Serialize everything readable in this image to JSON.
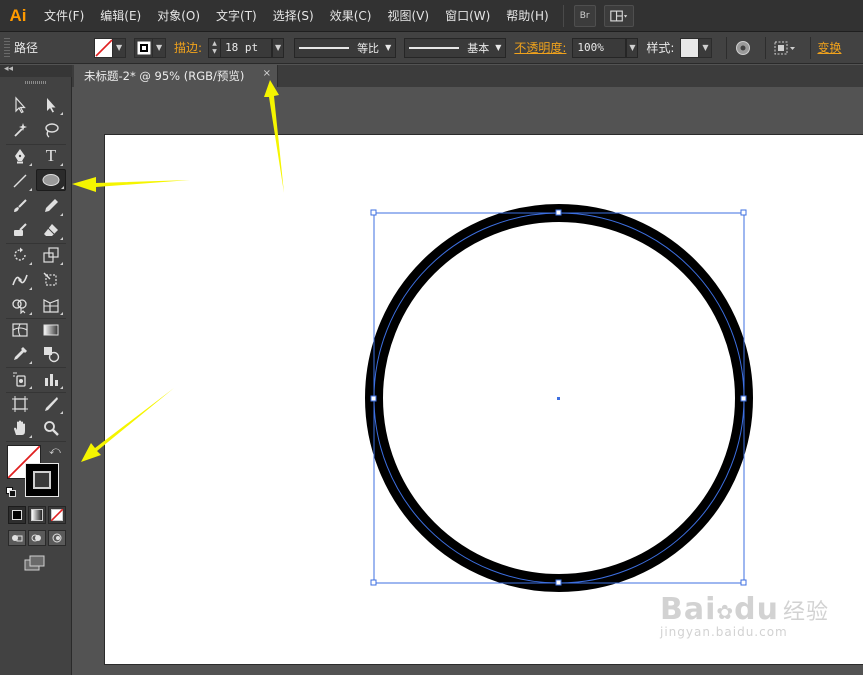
{
  "app": {
    "logo": "Ai"
  },
  "menu": [
    "文件(F)",
    "编辑(E)",
    "对象(O)",
    "文字(T)",
    "选择(S)",
    "效果(C)",
    "视图(V)",
    "窗口(W)",
    "帮助(H)"
  ],
  "menubar_buttons": {
    "bridge": "Br"
  },
  "controlbar": {
    "selection_type": "路径",
    "stroke_label": "描边:",
    "stroke_weight": "18 pt",
    "profile_label": "等比",
    "brush_label": "基本",
    "opacity_label": "不透明度:",
    "opacity_value": "100%",
    "style_label": "样式:",
    "transform_label": "变换"
  },
  "document": {
    "tab_title": "未标题-2* @ 95% (RGB/预览)",
    "tab_close": "×"
  },
  "tools": {
    "active": "ellipse-tool",
    "type_tool_glyph": "T"
  },
  "watermark": {
    "brand_latin": "Bai",
    "brand_du": "du",
    "brand_cn": "经验",
    "url": "jingyan.baidu.com"
  },
  "colors": {
    "accent_orange": "#f0a21c",
    "arrow_yellow": "#f5f500",
    "selection_blue": "#3d6fe0",
    "stroke_black": "#000000"
  }
}
